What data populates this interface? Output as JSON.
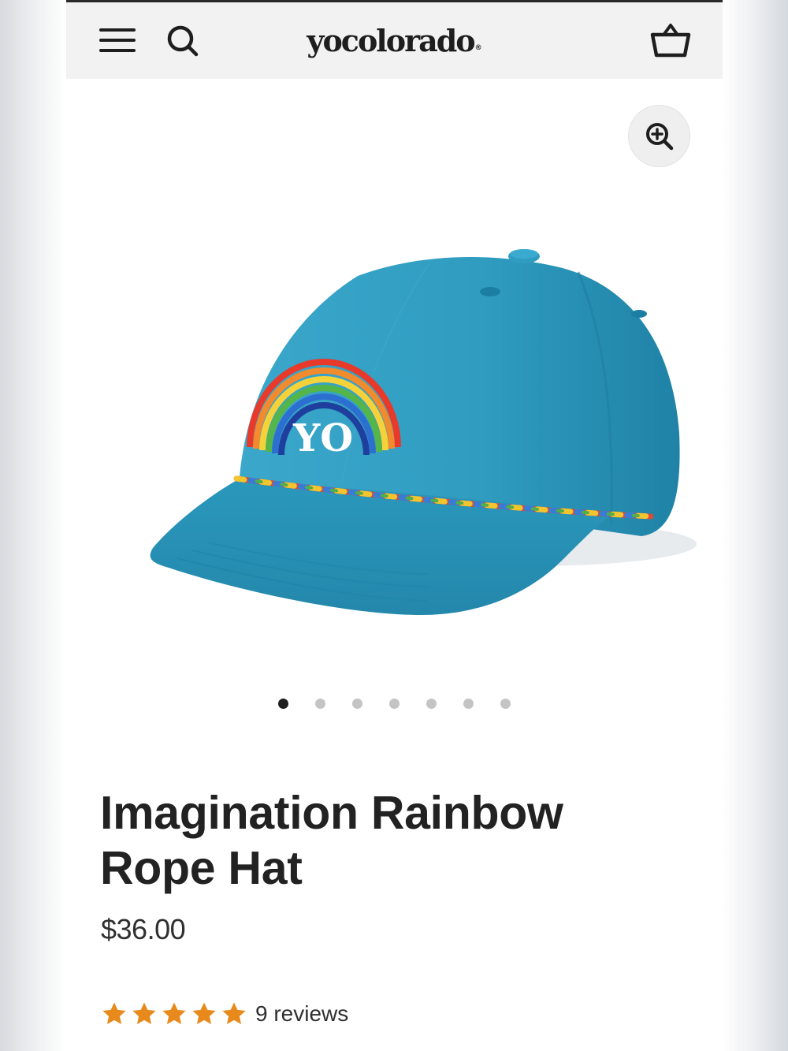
{
  "header": {
    "brand": "yocolorado",
    "brand_mark": "®",
    "icons": [
      "hamburger-menu-icon",
      "search-icon",
      "shopping-basket-icon"
    ]
  },
  "gallery": {
    "zoom_icon": "zoom-in-icon",
    "image_text": "YO",
    "slide_count": 7,
    "active_slide": 1
  },
  "product": {
    "title": "Imagination Rainbow Rope Hat",
    "price": "$36.00",
    "rating": 5,
    "reviews_label": "9 reviews"
  },
  "colors": {
    "hat": "#2a98bb",
    "star": "#e8891b",
    "header_bg": "#f2f2f2",
    "text": "#222222"
  }
}
